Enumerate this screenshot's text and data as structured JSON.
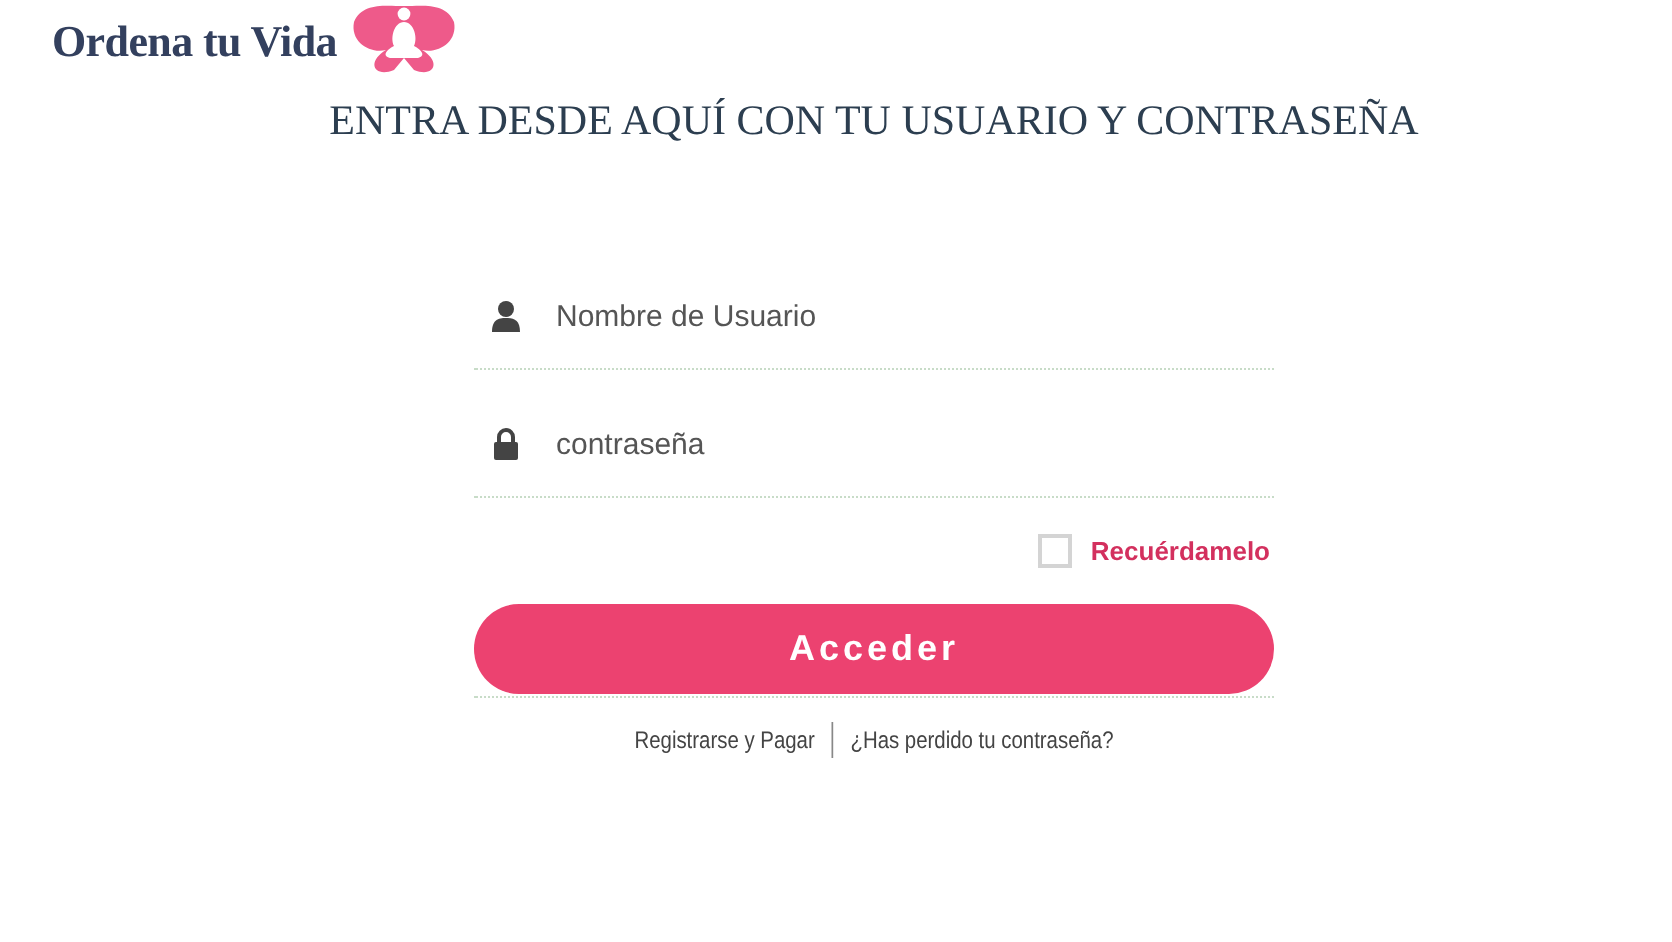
{
  "logo": {
    "text": "Ordena tu Vida"
  },
  "heading": "ENTRA DESDE AQUÍ CON TU USUARIO Y CONTRASEÑA",
  "form": {
    "fields": [
      {
        "kind": "user",
        "placeholder": "Nombre de Usuario"
      },
      {
        "kind": "password",
        "placeholder": "contraseña"
      }
    ],
    "remember": {
      "label": "Recuérdamelo",
      "checked": false
    },
    "submit": "Acceder",
    "links": [
      "Registrarse y Pagar",
      "¿Has perdido tu contraseña?"
    ]
  }
}
